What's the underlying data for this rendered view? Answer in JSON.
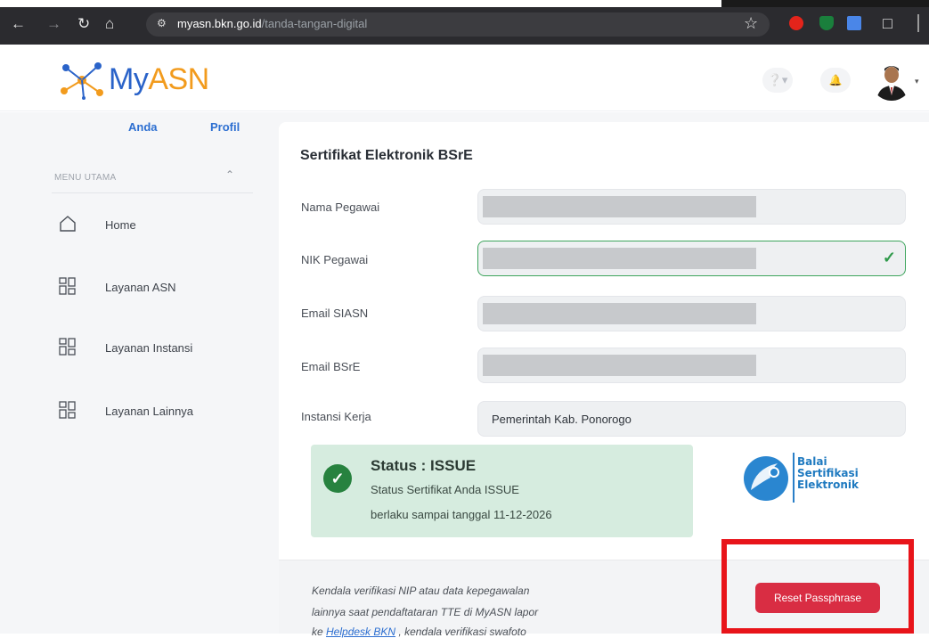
{
  "browser": {
    "url_domain": "myasn.bkn.go.id",
    "url_path": "/tanda-tangan-digital"
  },
  "header": {
    "logo_prefix": "My",
    "logo_suffix": "ASN",
    "help_icon": "help-icon",
    "bell_icon": "bell-icon"
  },
  "sidebar": {
    "link_anda": "Anda",
    "link_profil": "Profil",
    "menu_heading": "MENU UTAMA",
    "items": [
      {
        "label": "Home",
        "icon": "home-icon"
      },
      {
        "label": "Layanan ASN",
        "icon": "grid-icon"
      },
      {
        "label": "Layanan Instansi",
        "icon": "grid-icon"
      },
      {
        "label": "Layanan Lainnya",
        "icon": "grid-icon"
      }
    ]
  },
  "main": {
    "title": "Sertifikat Elektronik BSrE",
    "fields": [
      {
        "label": "Nama Pegawai",
        "value": ""
      },
      {
        "label": "NIK Pegawai",
        "value": ""
      },
      {
        "label": "Email SIASN",
        "value": ""
      },
      {
        "label": "Email BSrE",
        "value": ""
      },
      {
        "label": "Instansi Kerja",
        "value": "Pemerintah Kab. Ponorogo"
      }
    ],
    "status": {
      "title": "Status : ISSUE",
      "line1": "Status Sertifikat Anda ISSUE",
      "line2": "berlaku sampai tanggal 11-12-2026"
    },
    "bsre_logo": {
      "line1": "Balai",
      "line2": "Sertifikasi",
      "line3": "Elektronik"
    },
    "footer": {
      "note_line1": "Kendala verifikasi NIP atau data kepegawalan",
      "note_line2": "lainnya saat pendaftataran TTE di MyASN lapor",
      "note_line3_prefix": "ke ",
      "note_link": "Helpdesk BKN",
      "note_line3_suffix": " , kendala verifikasi swafoto"
    },
    "reset_button": "Reset Passphrase"
  },
  "colors": {
    "primary_blue": "#2d6fd1",
    "logo_orange": "#f29b1d",
    "status_green": "#27823f",
    "status_bg": "#d6ecdf",
    "reset_red": "#d92d43",
    "highlight_red": "#e8141a"
  }
}
